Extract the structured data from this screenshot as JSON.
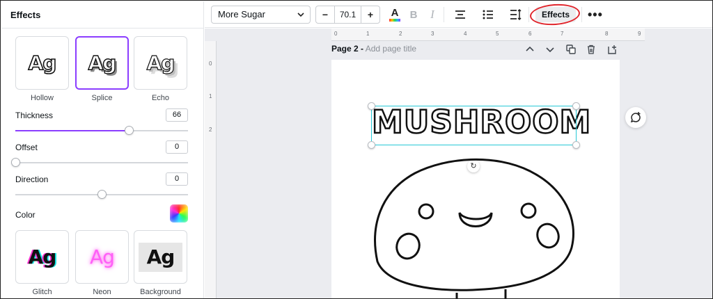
{
  "panel": {
    "title": "Effects",
    "styles_top": [
      {
        "name": "Hollow",
        "preview": "Ag"
      },
      {
        "name": "Splice",
        "preview": "Ag",
        "selected": true
      },
      {
        "name": "Echo",
        "preview": "Ag"
      }
    ],
    "thickness": {
      "label": "Thickness",
      "value": "66"
    },
    "offset": {
      "label": "Offset",
      "value": "0"
    },
    "direction": {
      "label": "Direction",
      "value": "0"
    },
    "color": {
      "label": "Color"
    },
    "styles_bottom": [
      {
        "name": "Glitch",
        "preview": "Ag"
      },
      {
        "name": "Neon",
        "preview": "Ag"
      },
      {
        "name": "Background",
        "preview": "Ag"
      }
    ]
  },
  "toolbar": {
    "font_name": "More Sugar",
    "font_size": "70.1",
    "decrease_label": "−",
    "increase_label": "+",
    "text_color_glyph": "A",
    "bold_glyph": "B",
    "italic_glyph": "I",
    "effects_label": "Effects",
    "more_label": "•••"
  },
  "canvas": {
    "page_label": "Page 2 -",
    "page_title_placeholder": "Add page title",
    "ruler_top_numbers": [
      "0",
      "1",
      "2",
      "3",
      "4",
      "5",
      "6",
      "7",
      "8",
      "9"
    ],
    "ruler_left_numbers": [
      "0",
      "1",
      "2"
    ],
    "text_element": "MUSHROOM"
  },
  "colors": {
    "accent": "#8b3dff",
    "selection": "#26c8d6",
    "annotation": "#e0242b"
  }
}
